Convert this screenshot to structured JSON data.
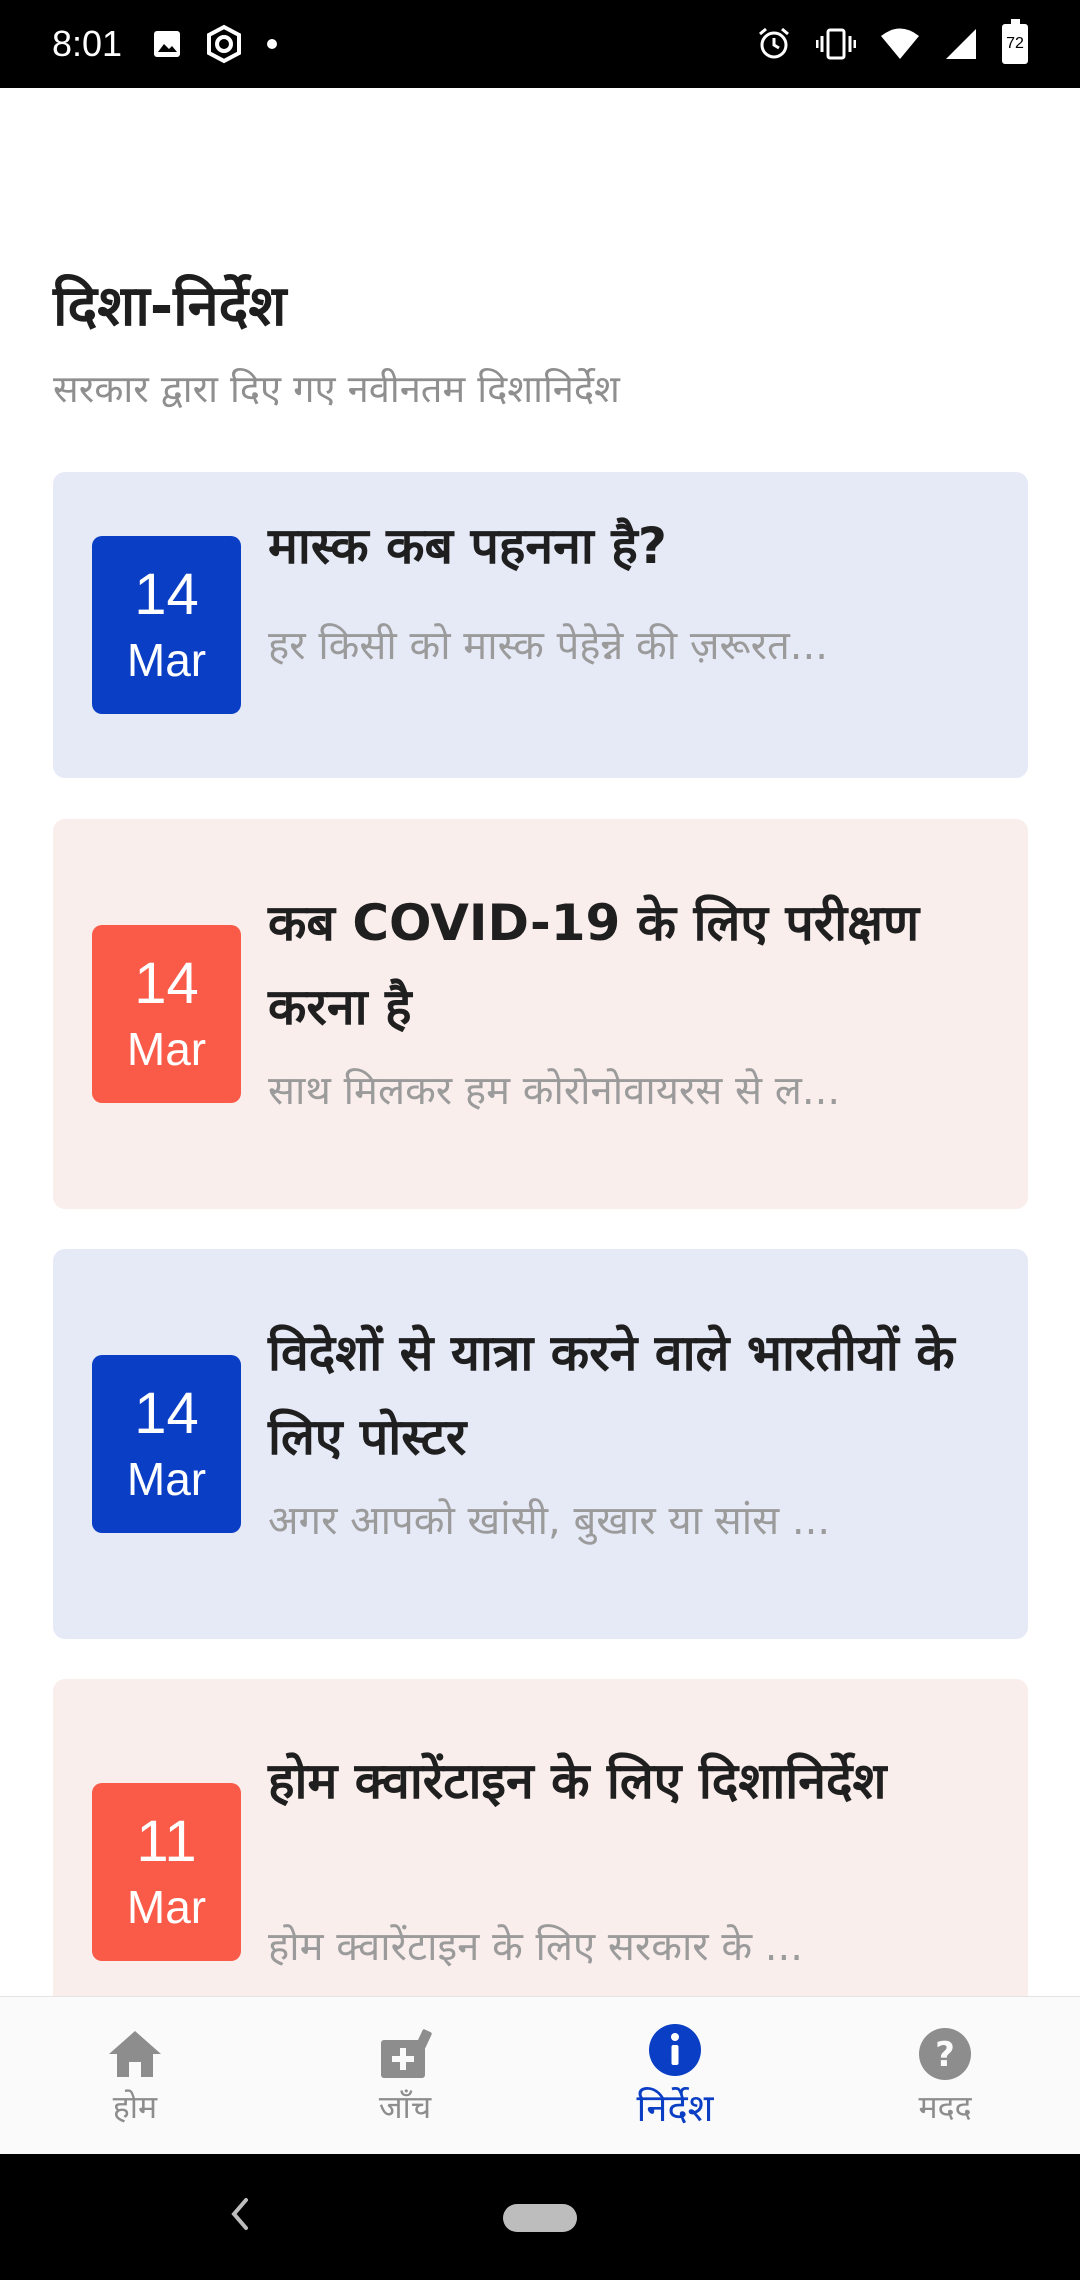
{
  "status_bar": {
    "time": "8:01",
    "battery": "72",
    "icons": [
      "image-icon",
      "shield-app-icon",
      "dot-icon",
      "alarm-icon",
      "vibrate-icon",
      "wifi-icon",
      "signal-icon",
      "battery-icon"
    ]
  },
  "header": {
    "title": "दिशा-निर्देश",
    "subtitle": "सरकार द्वारा दिए गए नवीनतम दिशानिर्देश"
  },
  "cards": [
    {
      "day": "14",
      "month": "Mar",
      "title": "मास्क कब पहनना है?",
      "description": "हर किसी को मास्क पेहेन्ने की ज़रूरत...",
      "theme": "blue"
    },
    {
      "day": "14",
      "month": "Mar",
      "title": "कब COVID-19 के लिए परीक्षण करना है",
      "description": "साथ मिलकर हम कोरोनोवायरस से ल...",
      "theme": "red"
    },
    {
      "day": "14",
      "month": "Mar",
      "title": "विदेशों से यात्रा करने वाले भारतीयों के लिए पोस्टर",
      "description": "अगर आपको खांसी, बुखार या सांस ...",
      "theme": "blue"
    },
    {
      "day": "11",
      "month": "Mar",
      "title": "होम क्वारेंटाइन के लिए दिशानिर्देश",
      "description": "होम क्वारेंटाइन के लिए सरकार के ...",
      "theme": "red"
    }
  ],
  "bottom_nav": {
    "items": [
      {
        "label": "होम",
        "icon": "home-icon",
        "active": false
      },
      {
        "label": "जाँच",
        "icon": "medical-kit-icon",
        "active": false
      },
      {
        "label": "निर्देश",
        "icon": "info-icon",
        "active": true
      },
      {
        "label": "मदद",
        "icon": "help-icon",
        "active": false
      }
    ]
  },
  "colors": {
    "primary_blue": "#0a3ec4",
    "accent_red": "#fa5a48",
    "card_blue_bg": "#e6eaf7",
    "card_red_bg": "#f9eeec"
  }
}
